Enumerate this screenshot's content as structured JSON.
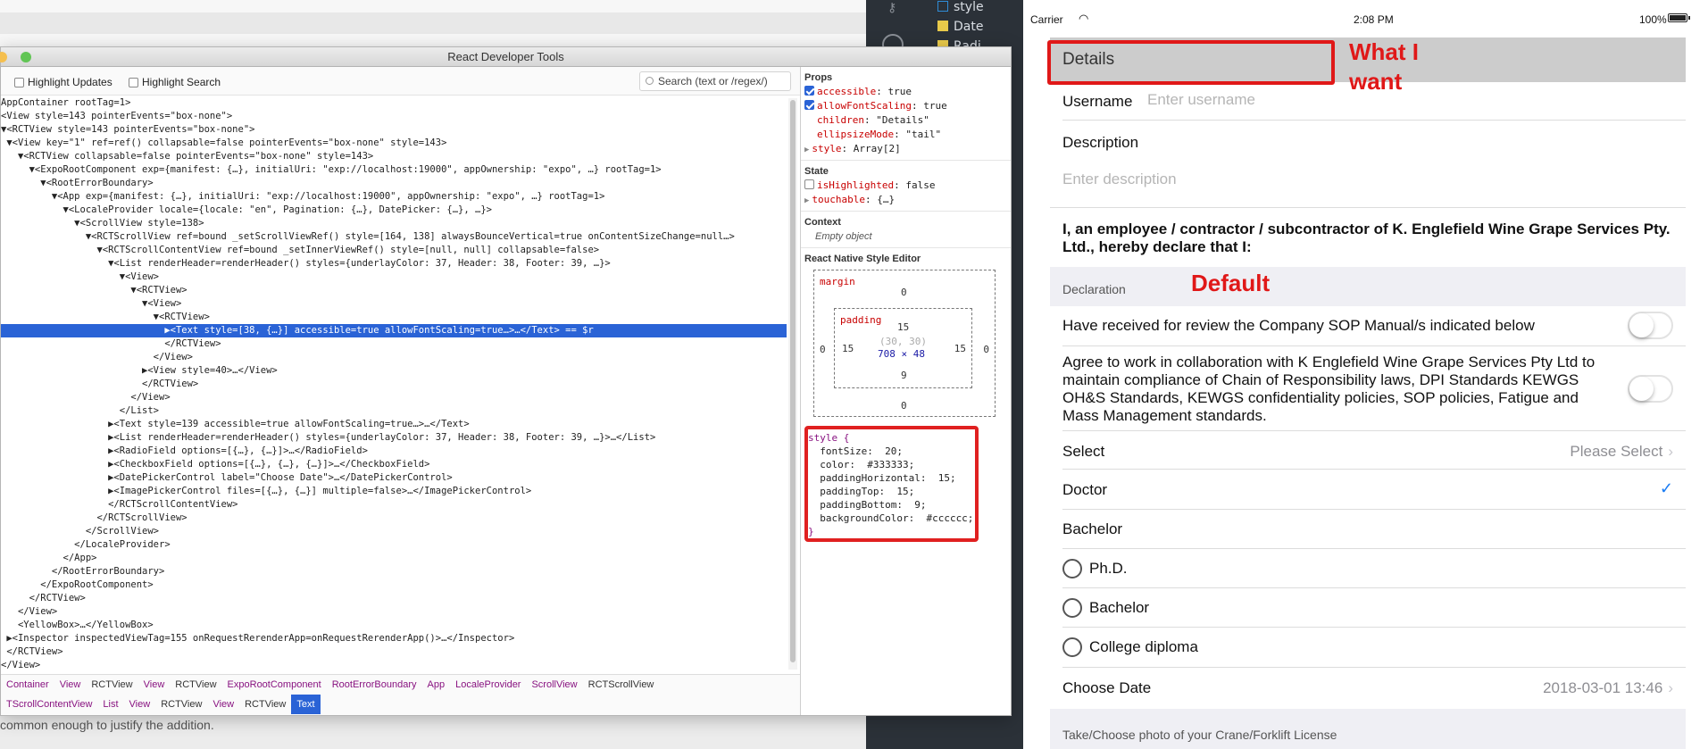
{
  "background_window": {
    "bottom_text": "common enough to justify the addition."
  },
  "editor": {
    "files": [
      {
        "label": "style",
        "icon": "css-file-icon",
        "color": "#2f8cd6"
      },
      {
        "label": "Date",
        "icon": "js-file-icon",
        "color": "#e8c94a"
      },
      {
        "label": "Radi",
        "icon": "js-file-icon",
        "color": "#e8c94a"
      }
    ]
  },
  "devtools": {
    "window_title": "React Developer Tools",
    "highlight_updates_label": "Highlight Updates",
    "highlight_search_label": "Highlight Search",
    "search_placeholder": "Search (text or /regex/)",
    "tree": [
      {
        "text": "AppContainer rootTag=1>"
      },
      {
        "text": "<View style=143 pointerEvents=\"box-none\">"
      },
      {
        "text": "▼<RCTView style=143 pointerEvents=\"box-none\">"
      },
      {
        "text": " ▼<View key=\"1\" ref=ref() collapsable=false pointerEvents=\"box-none\" style=143>"
      },
      {
        "text": "   ▼<RCTView collapsable=false pointerEvents=\"box-none\" style=143>"
      },
      {
        "text": "     ▼<ExpoRootComponent exp={manifest: {…}, initialUri: \"exp://localhost:19000\", appOwnership: \"expo\", …} rootTag=1>"
      },
      {
        "text": "       ▼<RootErrorBoundary>"
      },
      {
        "text": "         ▼<App exp={manifest: {…}, initialUri: \"exp://localhost:19000\", appOwnership: \"expo\", …} rootTag=1>"
      },
      {
        "text": "           ▼<LocaleProvider locale={locale: \"en\", Pagination: {…}, DatePicker: {…}, …}>"
      },
      {
        "text": "             ▼<ScrollView style=138>"
      },
      {
        "text": "               ▼<RCTScrollView ref=bound _setScrollViewRef() style=[164, 138] alwaysBounceVertical=true onContentSizeChange=null…>"
      },
      {
        "text": "                 ▼<RCTScrollContentView ref=bound _setInnerViewRef() style=[null, null] collapsable=false>"
      },
      {
        "text": "                   ▼<List renderHeader=renderHeader() styles={underlayColor: 37, Header: 38, Footer: 39, …}>"
      },
      {
        "text": "                     ▼<View>"
      },
      {
        "text": "                       ▼<RCTView>"
      },
      {
        "text": "                         ▼<View>"
      },
      {
        "text": "                           ▼<RCTView>"
      },
      {
        "text": "                             ▶<Text style=[38, {…}] accessible=true allowFontScaling=true…>…</Text> == $r",
        "selected": true
      },
      {
        "text": "                             </RCTView>"
      },
      {
        "text": "                           </View>"
      },
      {
        "text": "                         ▶<View style=40>…</View>"
      },
      {
        "text": "                         </RCTView>"
      },
      {
        "text": "                       </View>"
      },
      {
        "text": "                     </List>"
      },
      {
        "text": "                   ▶<Text style=139 accessible=true allowFontScaling=true…>…</Text>"
      },
      {
        "text": "                   ▶<List renderHeader=renderHeader() styles={underlayColor: 37, Header: 38, Footer: 39, …}>…</List>"
      },
      {
        "text": "                   ▶<RadioField options=[{…}, {…}]>…</RadioField>"
      },
      {
        "text": "                   ▶<CheckboxField options=[{…}, {…}, {…}]>…</CheckboxField>"
      },
      {
        "text": "                   ▶<DatePickerControl label=\"Choose Date\">…</DatePickerControl>"
      },
      {
        "text": "                   ▶<ImagePickerControl files=[{…}, {…}] multiple=false>…</ImagePickerControl>"
      },
      {
        "text": "                   </RCTScrollContentView>"
      },
      {
        "text": "                 </RCTScrollView>"
      },
      {
        "text": "               </ScrollView>"
      },
      {
        "text": "             </LocaleProvider>"
      },
      {
        "text": "           </App>"
      },
      {
        "text": "         </RootErrorBoundary>"
      },
      {
        "text": "       </ExpoRootComponent>"
      },
      {
        "text": "     </RCTView>"
      },
      {
        "text": "   </View>"
      },
      {
        "text": "   <YellowBox>…</YellowBox>"
      },
      {
        "text": " ▶<Inspector inspectedViewTag=155 onRequestRerenderApp=onRequestRerenderApp()>…</Inspector>"
      },
      {
        "text": " </RCTView>"
      },
      {
        "text": "</View>"
      }
    ],
    "breadcrumbs_row1": [
      "Container",
      "View",
      "RCTView",
      "View",
      "RCTView",
      "ExpoRootComponent",
      "RootErrorBoundary",
      "App",
      "LocaleProvider",
      "ScrollView",
      "RCTScrollView"
    ],
    "breadcrumbs_row2": [
      "TScrollContentView",
      "List",
      "View",
      "RCTView",
      "View",
      "RCTView",
      "Text"
    ],
    "props_title": "Props",
    "props": [
      {
        "checkbox": "on",
        "key": "accessible",
        "value": "true"
      },
      {
        "checkbox": "on",
        "key": "allowFontScaling",
        "value": "true"
      },
      {
        "key": "children",
        "value": "\"Details\""
      },
      {
        "key": "ellipsizeMode",
        "value": "\"tail\""
      },
      {
        "arrow": true,
        "key": "style",
        "value": "Array[2]"
      }
    ],
    "state_title": "State",
    "state": [
      {
        "checkbox": "off",
        "key": "isHighlighted",
        "value": "false"
      },
      {
        "arrow": true,
        "key": "touchable",
        "value": "{…}"
      }
    ],
    "context_title": "Context",
    "context_empty": "Empty object",
    "style_editor_title": "React Native Style Editor",
    "margin_label": "margin",
    "padding_label": "padding",
    "margin_top": "0",
    "margin_left": "0",
    "margin_right": "0",
    "margin_bottom": "0",
    "padding_top": "15",
    "padding_left": "15",
    "padding_right": "15",
    "padding_bottom": "9",
    "offset": "(30, 30)",
    "size": "708 × 48",
    "style_lines": [
      "style {",
      "  fontSize:  20;",
      "  color:  #333333;",
      "  paddingHorizontal:  15;",
      "  paddingTop:  15;",
      "  paddingBottom:  9;",
      "  backgroundColor:  #cccccc;",
      "}"
    ]
  },
  "simulator": {
    "carrier": "Carrier",
    "time": "2:08 PM",
    "battery": "100%",
    "details_label": "Details",
    "annotation_what_i_want_1": "What I",
    "annotation_what_i_want_2": "want",
    "username_label": "Username",
    "username_placeholder": "Enter username",
    "description_label": "Description",
    "description_placeholder": "Enter description",
    "declaration_text": "I, an employee / contractor / subcontractor of K. Englefield Wine Grape Services Pty. Ltd., hereby declare that I:",
    "declaration_section": "Declaration",
    "annotation_default": "Default",
    "toggle1_label": "Have received for review the Company SOP Manual/s indicated below",
    "toggle2_label": "Agree to work in collaboration with K Englefield Wine Grape Services Pty Ltd to maintain compliance of Chain of Responsibility laws, DPI Standards KEWGS OH&S Standards, KEWGS confidentiality policies, SOP policies, Fatigue and Mass Management standards.",
    "select_label": "Select",
    "select_value": "Please Select",
    "doctor_label": "Doctor",
    "bachelor_label": "Bachelor",
    "radio_options": [
      "Ph.D.",
      "Bachelor",
      "College diploma"
    ],
    "choose_date_label": "Choose Date",
    "choose_date_value": "2018-03-01 13:46",
    "photo_section": "Take/Choose photo of your Crane/Forklift License"
  }
}
